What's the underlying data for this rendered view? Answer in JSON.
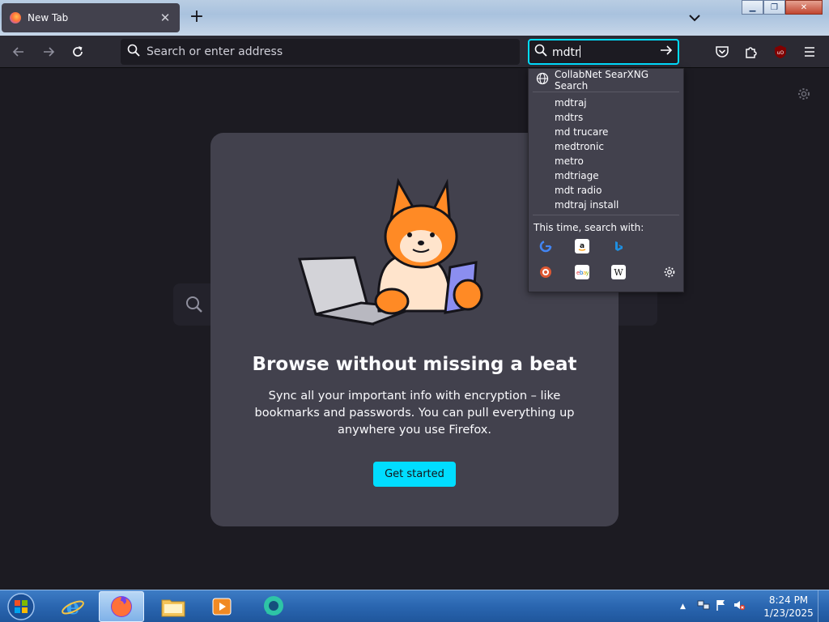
{
  "browser": {
    "tab": {
      "title": "New Tab",
      "close_glyph": "✕"
    },
    "newtab_glyph": "+",
    "address_placeholder": "Search or enter address",
    "search_box_value": "mdtr"
  },
  "dropdown": {
    "engine_name": "CollabNet SearXNG Search",
    "suggestions": [
      "mdtraj",
      "mdtrs",
      "md trucare",
      "medtronic",
      "metro",
      "mdtriage",
      "mdt radio",
      "mdtraj install"
    ],
    "this_time_label": "This time, search with:",
    "engines": [
      "google-icon",
      "amazon-icon",
      "bing-icon",
      "duckduckgo-icon",
      "ebay-icon",
      "wikipedia-icon",
      "search-settings-icon"
    ]
  },
  "promo": {
    "title": "Browse without missing a beat",
    "body": "Sync all your important info with encryption – like bookmarks and passwords. You can pull everything up anywhere you use Firefox.",
    "button": "Get started"
  },
  "taskbar": {
    "time": "8:24 PM",
    "date": "1/23/2025"
  },
  "colors": {
    "accent": "#00ddff",
    "toolbar": "#2b2a33",
    "page_bg": "#1c1b22",
    "card_bg": "#42414d"
  }
}
